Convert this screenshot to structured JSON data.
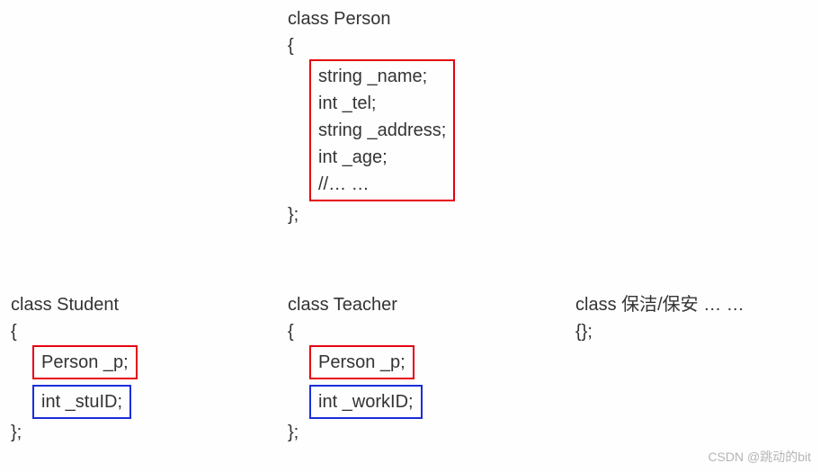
{
  "person": {
    "decl": "class Person",
    "open": "{",
    "members": {
      "l1": "string _name;",
      "l2": "int _tel;",
      "l3": "string _address;",
      "l4": "int _age;",
      "l5": "//… …"
    },
    "close": "};"
  },
  "student": {
    "decl": "class Student",
    "open": "{",
    "member1": "Person _p;",
    "member2": "int _stuID;",
    "close": "};"
  },
  "teacher": {
    "decl": "class Teacher",
    "open": "{",
    "member1": "Person _p;",
    "member2": "int _workID;",
    "close": "};"
  },
  "other": {
    "decl": "class 保洁/保安 … …",
    "body": "{};"
  },
  "watermark": "CSDN @跳动的bit"
}
